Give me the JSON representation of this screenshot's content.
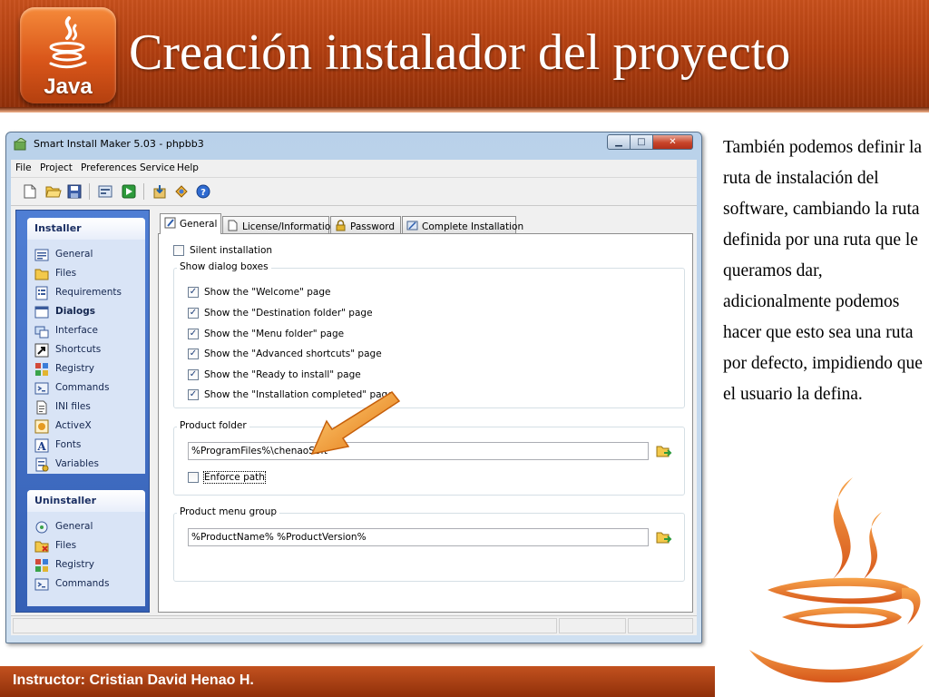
{
  "slide": {
    "title": "Creación instalador del proyecto",
    "logo_text": "Java",
    "description": "También podemos definir la ruta de instalación del software, cambiando la ruta definida por una ruta que le queramos dar, adicionalmente podemos hacer que esto sea una ruta por defecto, impidiendo que el usuario la defina.",
    "footer": "Instructor: Cristian David Henao H."
  },
  "app": {
    "window_title": "Smart Install Maker 5.03 - phpbb3",
    "window_controls": {
      "minimize": "▁",
      "maximize": "□",
      "close": "✕"
    },
    "menu": [
      "File",
      "Project",
      "Preferences",
      "Service",
      "Help"
    ],
    "toolbar_icons": [
      "new-icon",
      "open-icon",
      "save-icon",
      "build-icon",
      "run-icon",
      "import-icon",
      "export-icon",
      "help-icon"
    ],
    "sidebar": {
      "installer": {
        "title": "Installer",
        "items": [
          {
            "label": "General",
            "icon": "general-icon"
          },
          {
            "label": "Files",
            "icon": "folder-icon"
          },
          {
            "label": "Requirements",
            "icon": "requirements-icon"
          },
          {
            "label": "Dialogs",
            "icon": "dialogs-icon",
            "active": true
          },
          {
            "label": "Interface",
            "icon": "interface-icon"
          },
          {
            "label": "Shortcuts",
            "icon": "shortcut-icon"
          },
          {
            "label": "Registry",
            "icon": "registry-icon"
          },
          {
            "label": "Commands",
            "icon": "commands-icon"
          },
          {
            "label": "INI files",
            "icon": "ini-file-icon"
          },
          {
            "label": "ActiveX",
            "icon": "activex-icon"
          },
          {
            "label": "Fonts",
            "icon": "fonts-icon"
          },
          {
            "label": "Variables",
            "icon": "variables-icon"
          }
        ]
      },
      "uninstaller": {
        "title": "Uninstaller",
        "items": [
          {
            "label": "General",
            "icon": "general-icon"
          },
          {
            "label": "Files",
            "icon": "folder-icon"
          },
          {
            "label": "Registry",
            "icon": "registry-icon"
          },
          {
            "label": "Commands",
            "icon": "commands-icon"
          }
        ]
      }
    },
    "tabs": [
      {
        "label": "General",
        "icon": "edit-icon",
        "active": true
      },
      {
        "label": "License/Information",
        "icon": "document-icon"
      },
      {
        "label": "Password",
        "icon": "lock-icon"
      },
      {
        "label": "Complete Installation",
        "icon": "finish-icon"
      }
    ],
    "general": {
      "silent_installation": {
        "label": "Silent installation",
        "checked": false
      },
      "dialog_group_label": "Show dialog boxes",
      "dialog_options": [
        {
          "label": "Show the \"Welcome\" page",
          "checked": true
        },
        {
          "label": "Show the \"Destination folder\" page",
          "checked": true
        },
        {
          "label": "Show the \"Menu folder\" page",
          "checked": true
        },
        {
          "label": "Show the \"Advanced shortcuts\" page",
          "checked": true
        },
        {
          "label": "Show the \"Ready to install\" page",
          "checked": true
        },
        {
          "label": "Show the \"Installation completed\" page",
          "checked": true
        }
      ],
      "product_folder": {
        "group_label": "Product folder",
        "value": "%ProgramFiles%\\chenaoSoft",
        "enforce_path": {
          "label": "Enforce path",
          "checked": false
        }
      },
      "product_menu_group": {
        "group_label": "Product menu group",
        "value": "%ProductName% %ProductVersion%"
      }
    },
    "check_mark": "✓"
  },
  "colors": {
    "header_orange": "#b23f10",
    "footer_orange": "#c3521f",
    "sidebar_blue": "#3560b5",
    "arrow_orange": "#f28a1c",
    "java_orange": "#e8761e"
  }
}
